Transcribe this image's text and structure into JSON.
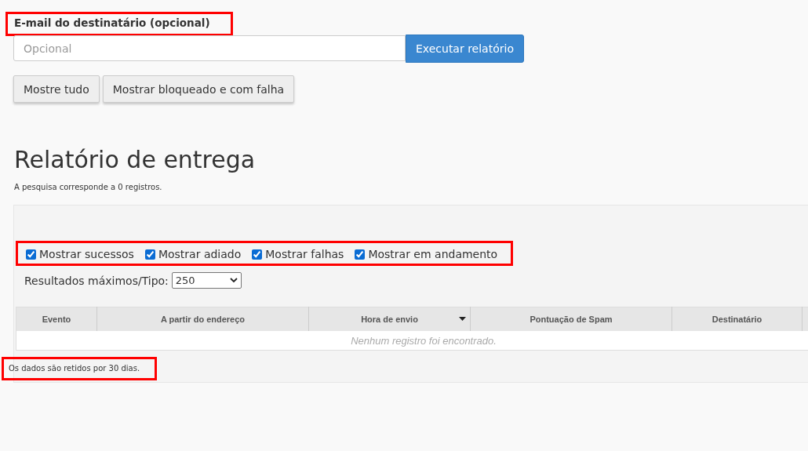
{
  "email": {
    "label": "E-mail do destinatário (opcional)",
    "highlighted": true,
    "placeholder": "Opcional",
    "run_button": "Executar relatório"
  },
  "filter_buttons": [
    "Mostre tudo",
    "Mostrar bloqueado e com falha"
  ],
  "report": {
    "title": "Relatório de entrega",
    "summary": "A pesquisa corresponde a 0 registros.",
    "checkboxes_highlighted": true,
    "checkboxes": [
      {
        "label": "Mostrar sucessos",
        "checked": true
      },
      {
        "label": "Mostrar adiado",
        "checked": true
      },
      {
        "label": "Mostrar falhas",
        "checked": true
      },
      {
        "label": "Mostrar em andamento",
        "checked": true
      }
    ],
    "max_results": {
      "label": "Resultados máximos/Tipo:",
      "value": "250"
    },
    "table": {
      "columns": [
        {
          "label": "Evento",
          "sorted": false
        },
        {
          "label": "A partir do endereço",
          "sorted": false
        },
        {
          "label": "Hora de envio",
          "sorted": true
        },
        {
          "label": "Pontuação de Spam",
          "sorted": false
        },
        {
          "label": "Destinatário",
          "sorted": false
        }
      ],
      "empty_message": "Nenhum registro foi encontrado."
    },
    "note": "Os dados são retidos por 30 dias.",
    "note_highlighted": true
  }
}
